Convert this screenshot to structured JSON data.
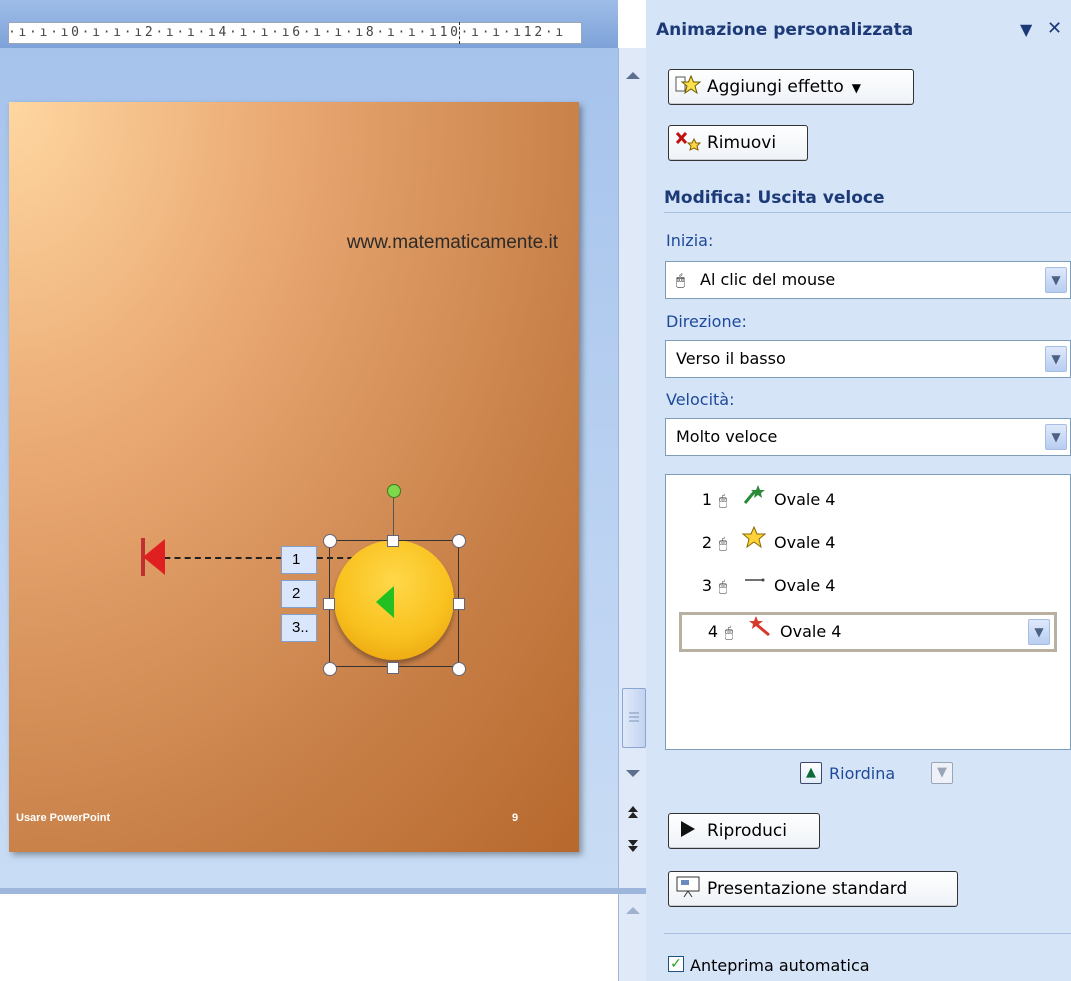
{
  "ruler": {
    "numbers": "·ı·ı·ı0·ı·ı·ı2·ı·ı·ı4·ı·ı·ı6·ı·ı·ı8·ı·ı·ı10·ı·ı·ı12·ı"
  },
  "slide": {
    "url_text": "www.matematicamente.it",
    "footer_left": "Usare PowerPoint",
    "footer_right": "9",
    "animation_tags": [
      "1",
      "2",
      "3.."
    ]
  },
  "pane": {
    "title": "Animazione personalizzata",
    "add_effect_label": "Aggiungi effetto",
    "remove_label": "Rimuovi",
    "section_title": "Modifica: Uscita veloce",
    "start": {
      "label": "Inizia:",
      "value": "Al clic del mouse"
    },
    "direction": {
      "label": "Direzione:",
      "value": "Verso il basso"
    },
    "speed": {
      "label": "Velocità:",
      "value": "Molto veloce"
    },
    "effects": [
      {
        "n": "1",
        "name": "Ovale 4"
      },
      {
        "n": "2",
        "name": "Ovale 4"
      },
      {
        "n": "3",
        "name": "Ovale 4"
      },
      {
        "n": "4",
        "name": "Ovale 4"
      }
    ],
    "reorder_label": "Riordina",
    "play_label": "Riproduci",
    "slideshow_label": "Presentazione standard",
    "autopreview_label": "Anteprima automatica",
    "autopreview_checked": true
  },
  "colors": {
    "pane_title": "#1d3a78",
    "label_blue": "#1d4a9a",
    "slide_dark": "#b7682c",
    "slide_light": "#ffd7a1"
  }
}
